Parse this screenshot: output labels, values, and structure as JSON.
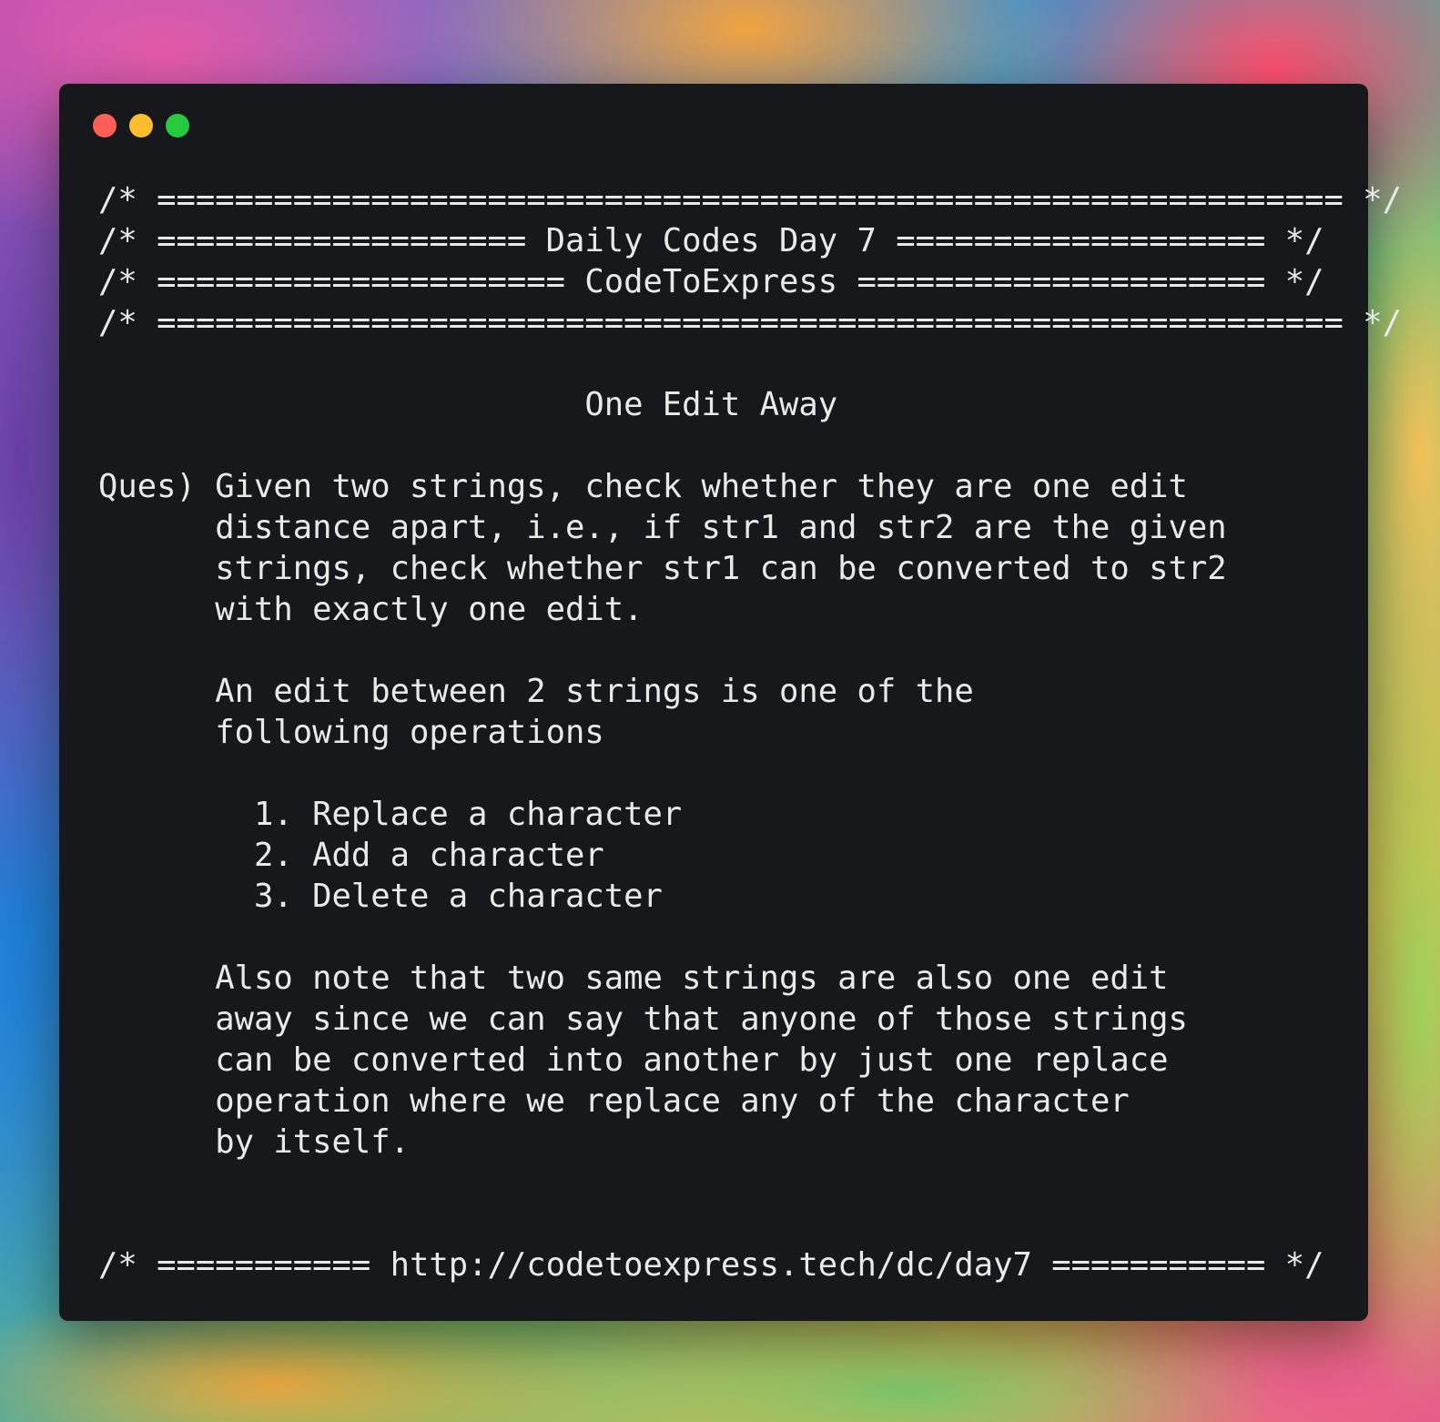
{
  "window": {
    "background_color": "#17181b",
    "controls": [
      {
        "name": "close",
        "color": "#ff5f56"
      },
      {
        "name": "minimize",
        "color": "#ffbd2e"
      },
      {
        "name": "maximize",
        "color": "#27c93f"
      }
    ]
  },
  "code": {
    "text_color": "#e9e9e9",
    "lines": [
      "/* ============================================================= */",
      "/* =================== Daily Codes Day 7 =================== */",
      "/* ===================== CodeToExpress ===================== */",
      "/* ============================================================= */",
      "",
      "                         One Edit Away",
      "",
      "Ques) Given two strings, check whether they are one edit",
      "      distance apart, i.e., if str1 and str2 are the given",
      "      strings, check whether str1 can be converted to str2",
      "      with exactly one edit.",
      "",
      "      An edit between 2 strings is one of the",
      "      following operations",
      "",
      "        1. Replace a character",
      "        2. Add a character",
      "        3. Delete a character",
      "",
      "      Also note that two same strings are also one edit",
      "      away since we can say that anyone of those strings",
      "      can be converted into another by just one replace",
      "      operation where we replace any of the character",
      "      by itself.",
      "",
      "",
      "/* =========== http://codetoexpress.tech/dc/day7 =========== */"
    ]
  }
}
